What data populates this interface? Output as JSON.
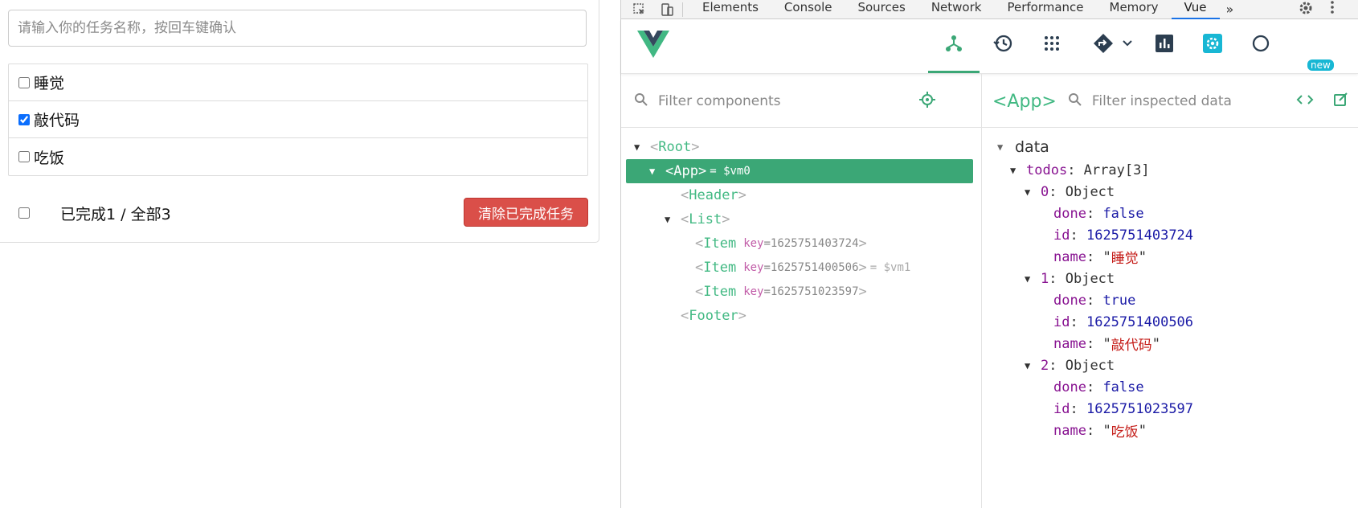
{
  "app": {
    "input_placeholder": "请输入你的任务名称，按回车键确认",
    "todos": [
      {
        "label": "睡觉",
        "done": false
      },
      {
        "label": "敲代码",
        "done": true
      },
      {
        "label": "吃饭",
        "done": false
      }
    ],
    "footer": {
      "stats": "已完成1 / 全部3",
      "clear_button": "清除已完成任务"
    },
    "colors": {
      "danger": "#da4f49"
    }
  },
  "devtools": {
    "tabs": [
      "Elements",
      "Console",
      "Sources",
      "Network",
      "Performance",
      "Memory",
      "Vue"
    ],
    "active_tab": "Vue",
    "more": "»",
    "vue": {
      "new_badge": "new",
      "filter_components_placeholder": "Filter components",
      "inspected_component": "<App>",
      "filter_inspected_placeholder": "Filter inspected data",
      "tree": {
        "root": {
          "open": "<",
          "name": "Root",
          "close": ">"
        },
        "app": {
          "open": "<",
          "name": "App",
          "close": ">",
          "ref": "= $vm0"
        },
        "header": {
          "open": "<",
          "name": "Header",
          "close": ">"
        },
        "list": {
          "open": "<",
          "name": "List",
          "close": ">"
        },
        "items": [
          {
            "open": "<",
            "name": "Item",
            "key_label": "key",
            "key_value": "=1625751403724",
            "close": ">",
            "ref": ""
          },
          {
            "open": "<",
            "name": "Item",
            "key_label": "key",
            "key_value": "=1625751400506",
            "close": ">",
            "ref": "= $vm1"
          },
          {
            "open": "<",
            "name": "Item",
            "key_label": "key",
            "key_value": "=1625751023597",
            "close": ">",
            "ref": ""
          }
        ],
        "footer": {
          "open": "<",
          "name": "Footer",
          "close": ">"
        }
      },
      "data": {
        "section": "data",
        "todos_label": "todos",
        "todos_type": "Array[3]",
        "objects": [
          {
            "index": "0",
            "type": "Object",
            "done": "false",
            "id": "1625751403724",
            "name": "睡觉"
          },
          {
            "index": "1",
            "type": "Object",
            "done": "true",
            "id": "1625751400506",
            "name": "敲代码"
          },
          {
            "index": "2",
            "type": "Object",
            "done": "false",
            "id": "1625751023597",
            "name": "吃饭"
          }
        ],
        "labels": {
          "done": "done",
          "id": "id",
          "name": "name"
        }
      }
    },
    "colors": {
      "vue_green": "#3ba776",
      "accent": "#1a73e8",
      "badge": "#18b7d4"
    }
  }
}
